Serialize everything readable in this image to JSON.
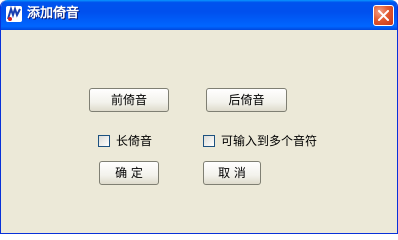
{
  "window": {
    "title": "添加倚音",
    "close_label": "✕"
  },
  "buttons": {
    "front_grace": "前倚音",
    "back_grace": "后倚音",
    "ok": "确 定",
    "cancel": "取 消"
  },
  "checkboxes": {
    "long_grace": {
      "label": "长倚音",
      "checked": false
    },
    "multi_notes": {
      "label": "可输入到多个音符",
      "checked": false
    }
  },
  "colors": {
    "titlebar": "#0054e3",
    "dialog_bg": "#ece9d8",
    "close_button": "#e25a2f"
  }
}
